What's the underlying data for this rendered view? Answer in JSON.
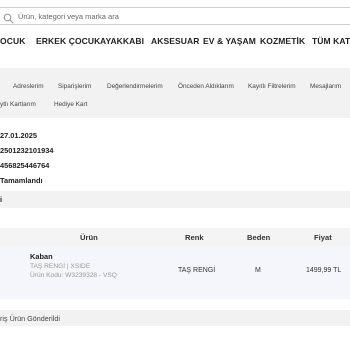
{
  "search": {
    "placeholder": "Ürün, kategori veya marka ara"
  },
  "categories": [
    "OCUK",
    "ERKEK ÇOCUK",
    "AYAKKABI",
    "AKSESUAR",
    "EV & YAŞAM",
    "KOZMETİK",
    "TÜM KATEG"
  ],
  "account_tabs": {
    "row1": [
      "Adreslerim",
      "Siparişlerim",
      "Değerlendirmelerim",
      "Önceden Aldıklarım",
      "Kayıtlı Filtrelerim",
      "Mesajlarım"
    ],
    "row2": [
      "ytlı Kartlarım",
      "Hediye Kart"
    ]
  },
  "order_info": {
    "date": "27.01.2025",
    "order_no": "2501232101934",
    "tracking_no": "456825446764",
    "status": "Tamamlandı"
  },
  "section_band_text": "i",
  "table": {
    "headers": {
      "product": "Ürün",
      "color": "Renk",
      "size": "Beden",
      "price": "Fiyat"
    },
    "row": {
      "name": "Kaban",
      "variant": "TAŞ RENGİ | XSIDE",
      "code": "Ürün Kodu: W3239328 - VSQ",
      "color": "TAŞ RENGİ",
      "size": "M",
      "price": "1499,99 TL"
    }
  },
  "footer_text": "riş Ürün Gönderildi"
}
